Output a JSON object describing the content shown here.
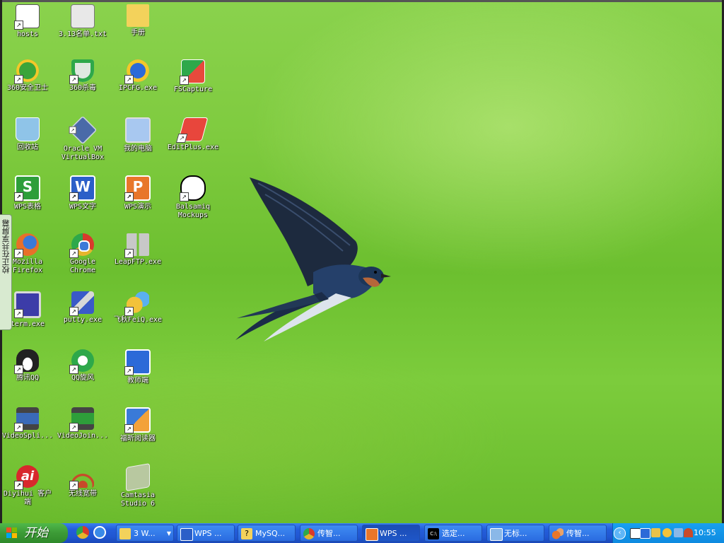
{
  "desktop": {
    "icons": [
      {
        "label": "hosts",
        "icon": "text-file-icon",
        "color": "#ffffff"
      },
      {
        "label": "3.13名单.txt",
        "icon": "notepad-file-icon",
        "color": "#e8e8e8"
      },
      {
        "label": "手册",
        "icon": "folder-icon",
        "color": "#f3d25b"
      },
      {
        "label": "360安全卫士",
        "icon": "360-safe-icon",
        "color": "#3aa43a"
      },
      {
        "label": "360杀毒",
        "icon": "360-antivirus-icon",
        "color": "#dfe8e0"
      },
      {
        "label": "IPCFG.exe",
        "icon": "ipcfg-icon",
        "color": "#2c6ad8"
      },
      {
        "label": "FSCapture",
        "icon": "fscapture-icon",
        "color": "#e84a3c"
      },
      {
        "label": "回收站",
        "icon": "recycle-bin-icon",
        "color": "#8fc4e8"
      },
      {
        "label": "Oracle VM\nVirtualBox",
        "icon": "virtualbox-icon",
        "color": "#4a6aa8"
      },
      {
        "label": "我的电脑",
        "icon": "my-computer-icon",
        "color": "#a8c8f0"
      },
      {
        "label": "EditPlus.exe",
        "icon": "editplus-icon",
        "color": "#e8463c"
      },
      {
        "label": "WPS表格",
        "icon": "wps-spreadsheet-icon",
        "color": "#2e9e3a"
      },
      {
        "label": "WPS文字",
        "icon": "wps-writer-icon",
        "color": "#2b5fc8"
      },
      {
        "label": "WPS演示",
        "icon": "wps-presentation-icon",
        "color": "#e8762a"
      },
      {
        "label": "Balsamiq\nMockups",
        "icon": "balsamiq-icon",
        "color": "#ffffff"
      },
      {
        "label": "Mozilla\nFirefox",
        "icon": "firefox-icon",
        "color": "#e8702a"
      },
      {
        "label": "Google\nChrome",
        "icon": "chrome-icon",
        "color": "#e6b52c"
      },
      {
        "label": "LeapFTP.exe",
        "icon": "leapftp-icon",
        "color": "#c8c8c8"
      },
      {
        "label": "term.exe",
        "icon": "term-icon",
        "color": "#3c3ca8"
      },
      {
        "label": "putty.exe",
        "icon": "putty-icon",
        "color": "#3a5ac8"
      },
      {
        "label": "飞秋FeiQ.exe",
        "icon": "feiq-icon",
        "color": "#f2c23a"
      },
      {
        "label": "腾讯QQ",
        "icon": "qq-icon",
        "color": "#222222"
      },
      {
        "label": "QQ旋风",
        "icon": "qq-whirlwind-icon",
        "color": "#2ea84a"
      },
      {
        "label": "教师端",
        "icon": "teacher-client-icon",
        "color": "#2c6ad8"
      },
      {
        "label": "VideoSpli...",
        "icon": "videosplitter-icon",
        "color": "#3a6ab8"
      },
      {
        "label": "VideoJoin...",
        "icon": "videojoiner-icon",
        "color": "#2e9e3a"
      },
      {
        "label": "福昕阅读器",
        "icon": "foxit-reader-icon",
        "color": "#3a7ad8"
      },
      {
        "label": "Diyihui 客户\n端",
        "icon": "diyihui-icon",
        "color": "#d8282c"
      },
      {
        "label": "无线宽带",
        "icon": "wireless-broadband-icon",
        "color": "#c84a2a"
      },
      {
        "label": "Camtasia\nStudio 6",
        "icon": "camtasia-icon",
        "color": "#b8c8a0"
      }
    ],
    "share_tab": "校正在共享屏幕"
  },
  "taskbar": {
    "start_label": "开始",
    "quicklaunch": [
      {
        "icon": "chrome-icon",
        "color": "#e6b52c"
      },
      {
        "icon": "ie-icon",
        "color": "#3a8ae8"
      }
    ],
    "items": [
      {
        "label": "3 W...",
        "icon": "folder-icon",
        "color": "#f3d25b"
      },
      {
        "label": "WPS ...",
        "icon": "wps-writer-icon",
        "color": "#2b5fc8"
      },
      {
        "label": "MySQ...",
        "icon": "help-icon",
        "color": "#f3d25b"
      },
      {
        "label": "传智...",
        "icon": "chrome-icon",
        "color": "#e6b52c"
      },
      {
        "label": "WPS ...",
        "icon": "wps-presentation-icon",
        "color": "#e8762a"
      },
      {
        "label": "选定...",
        "icon": "cmd-icon",
        "color": "#000000"
      },
      {
        "label": "无标...",
        "icon": "notepad-icon",
        "color": "#8ab8e8"
      },
      {
        "label": "传智...",
        "icon": "feiq-icon",
        "color": "#e8762a"
      }
    ],
    "clock": "10:55"
  }
}
